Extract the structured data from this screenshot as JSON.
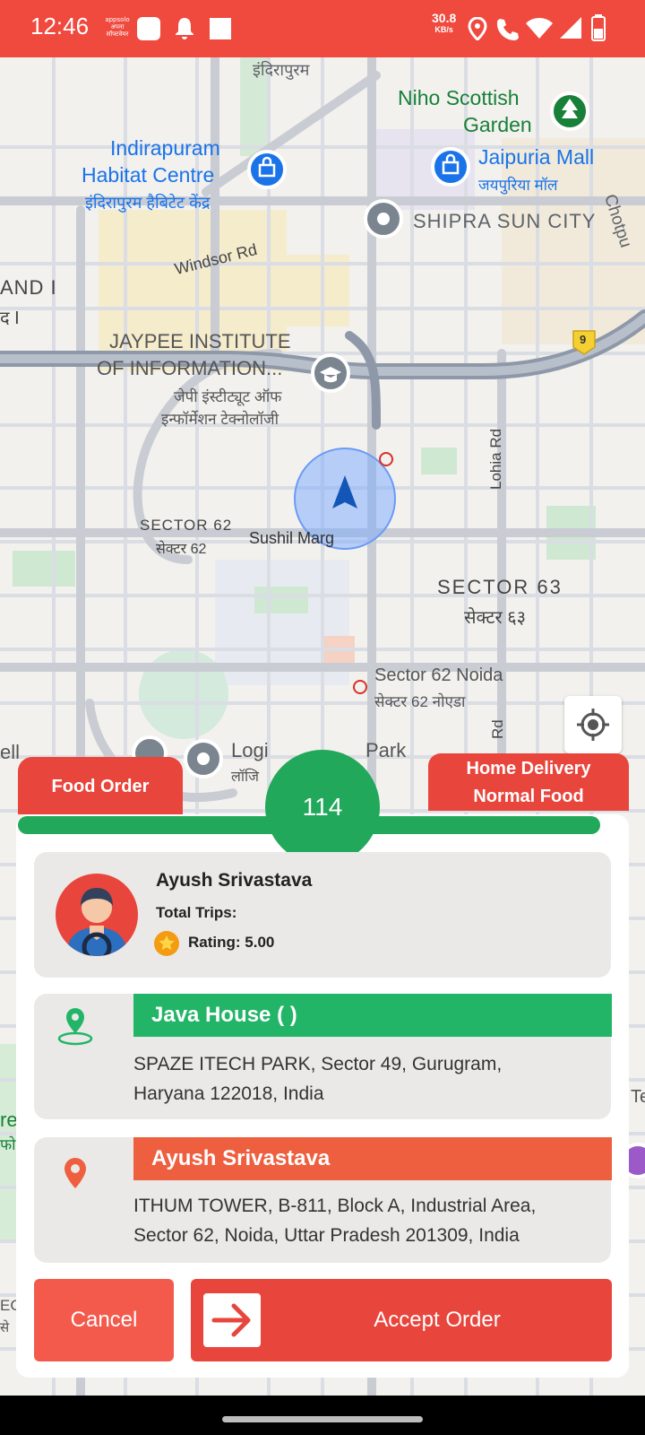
{
  "status_bar": {
    "time": "12:46",
    "app_note_1": "appsolo",
    "app_note_2": "अपना सॉफ्टवेयर",
    "speed_value": "30.8",
    "speed_unit": "KB/s",
    "icons": [
      "notification-square-icon",
      "bell-icon",
      "square-icon",
      "location-icon",
      "wifi-call-icon",
      "wifi-icon",
      "signal-icon",
      "battery-icon"
    ]
  },
  "map": {
    "labels": {
      "indirapuram_top": "इंदिरापुरम",
      "niho_1": "Niho Scottish",
      "niho_2": "Garden",
      "habitat_1": "Indirapuram",
      "habitat_2": "Habitat Centre",
      "habitat_hi": "इंदिरापुरम हैबिटेट केंद्र",
      "jaipuria": "Jaipuria Mall",
      "jaipuria_hi": "जयपुरिया मॉल",
      "chotpur": "Chotpu",
      "shipra": "SHIPRA SUN CITY",
      "windsor": "Windsor Rd",
      "land_1": "AND I",
      "land_2": "द I",
      "jaypee_1": "JAYPEE INSTITUTE",
      "jaypee_2": "OF INFORMATION...",
      "jaypee_hi_1": "जेपी इंस्टीट्यूट ऑफ",
      "jaypee_hi_2": "इन्फॉर्मेशन टेक्नोलॉजी",
      "highway": "9",
      "lohia": "Lohia Rd",
      "sector62": "SECTOR 62",
      "sector62_hi": "सेक्टर 62",
      "sushil": "Sushil Marg",
      "sector63": "SECTOR 63",
      "sector63_hi": "सेक्टर ६३",
      "noida_1": "Sector 62 Noida",
      "noida_hi": "सेक्टर 62 नोएडा",
      "rd": "Rd",
      "logix_1": "Logi",
      "logix_2": "Park",
      "logix_hi": "लॉजि",
      "left_partial": "ell",
      "left_partial_2": "re",
      "left_partial_3": "फो",
      "right_partial": "Te",
      "bottom_left": "EC",
      "bottom_left_hi": "से"
    },
    "colors": {
      "road": "#c9ccd3",
      "highway": "#8e98a8",
      "green": "#cfe8d2",
      "water": "#aadaff"
    }
  },
  "order": {
    "tab_left": "Food Order",
    "tab_right_1": "Home Delivery",
    "tab_right_2": "Normal Food",
    "timer": "114",
    "driver": {
      "name": "Ayush Srivastava",
      "trips_label": "Total Trips:",
      "rating_label": "Rating: 5.00"
    },
    "pickup": {
      "name": "Java House ( )",
      "address_1": "SPAZE ITECH PARK, Sector 49, Gurugram,",
      "address_2": "Haryana 122018, India"
    },
    "drop": {
      "name": "Ayush Srivastava",
      "address_1": "ITHUM TOWER, B-811, Block A, Industrial Area,",
      "address_2": "Sector 62, Noida, Uttar Pradesh 201309, India"
    },
    "cancel_label": "Cancel",
    "accept_label": "Accept Order"
  },
  "colors": {
    "brand_red": "#e8453c",
    "brand_green": "#22a85a",
    "pickup_green": "#22b567",
    "drop_orange": "#ee5f3f"
  }
}
